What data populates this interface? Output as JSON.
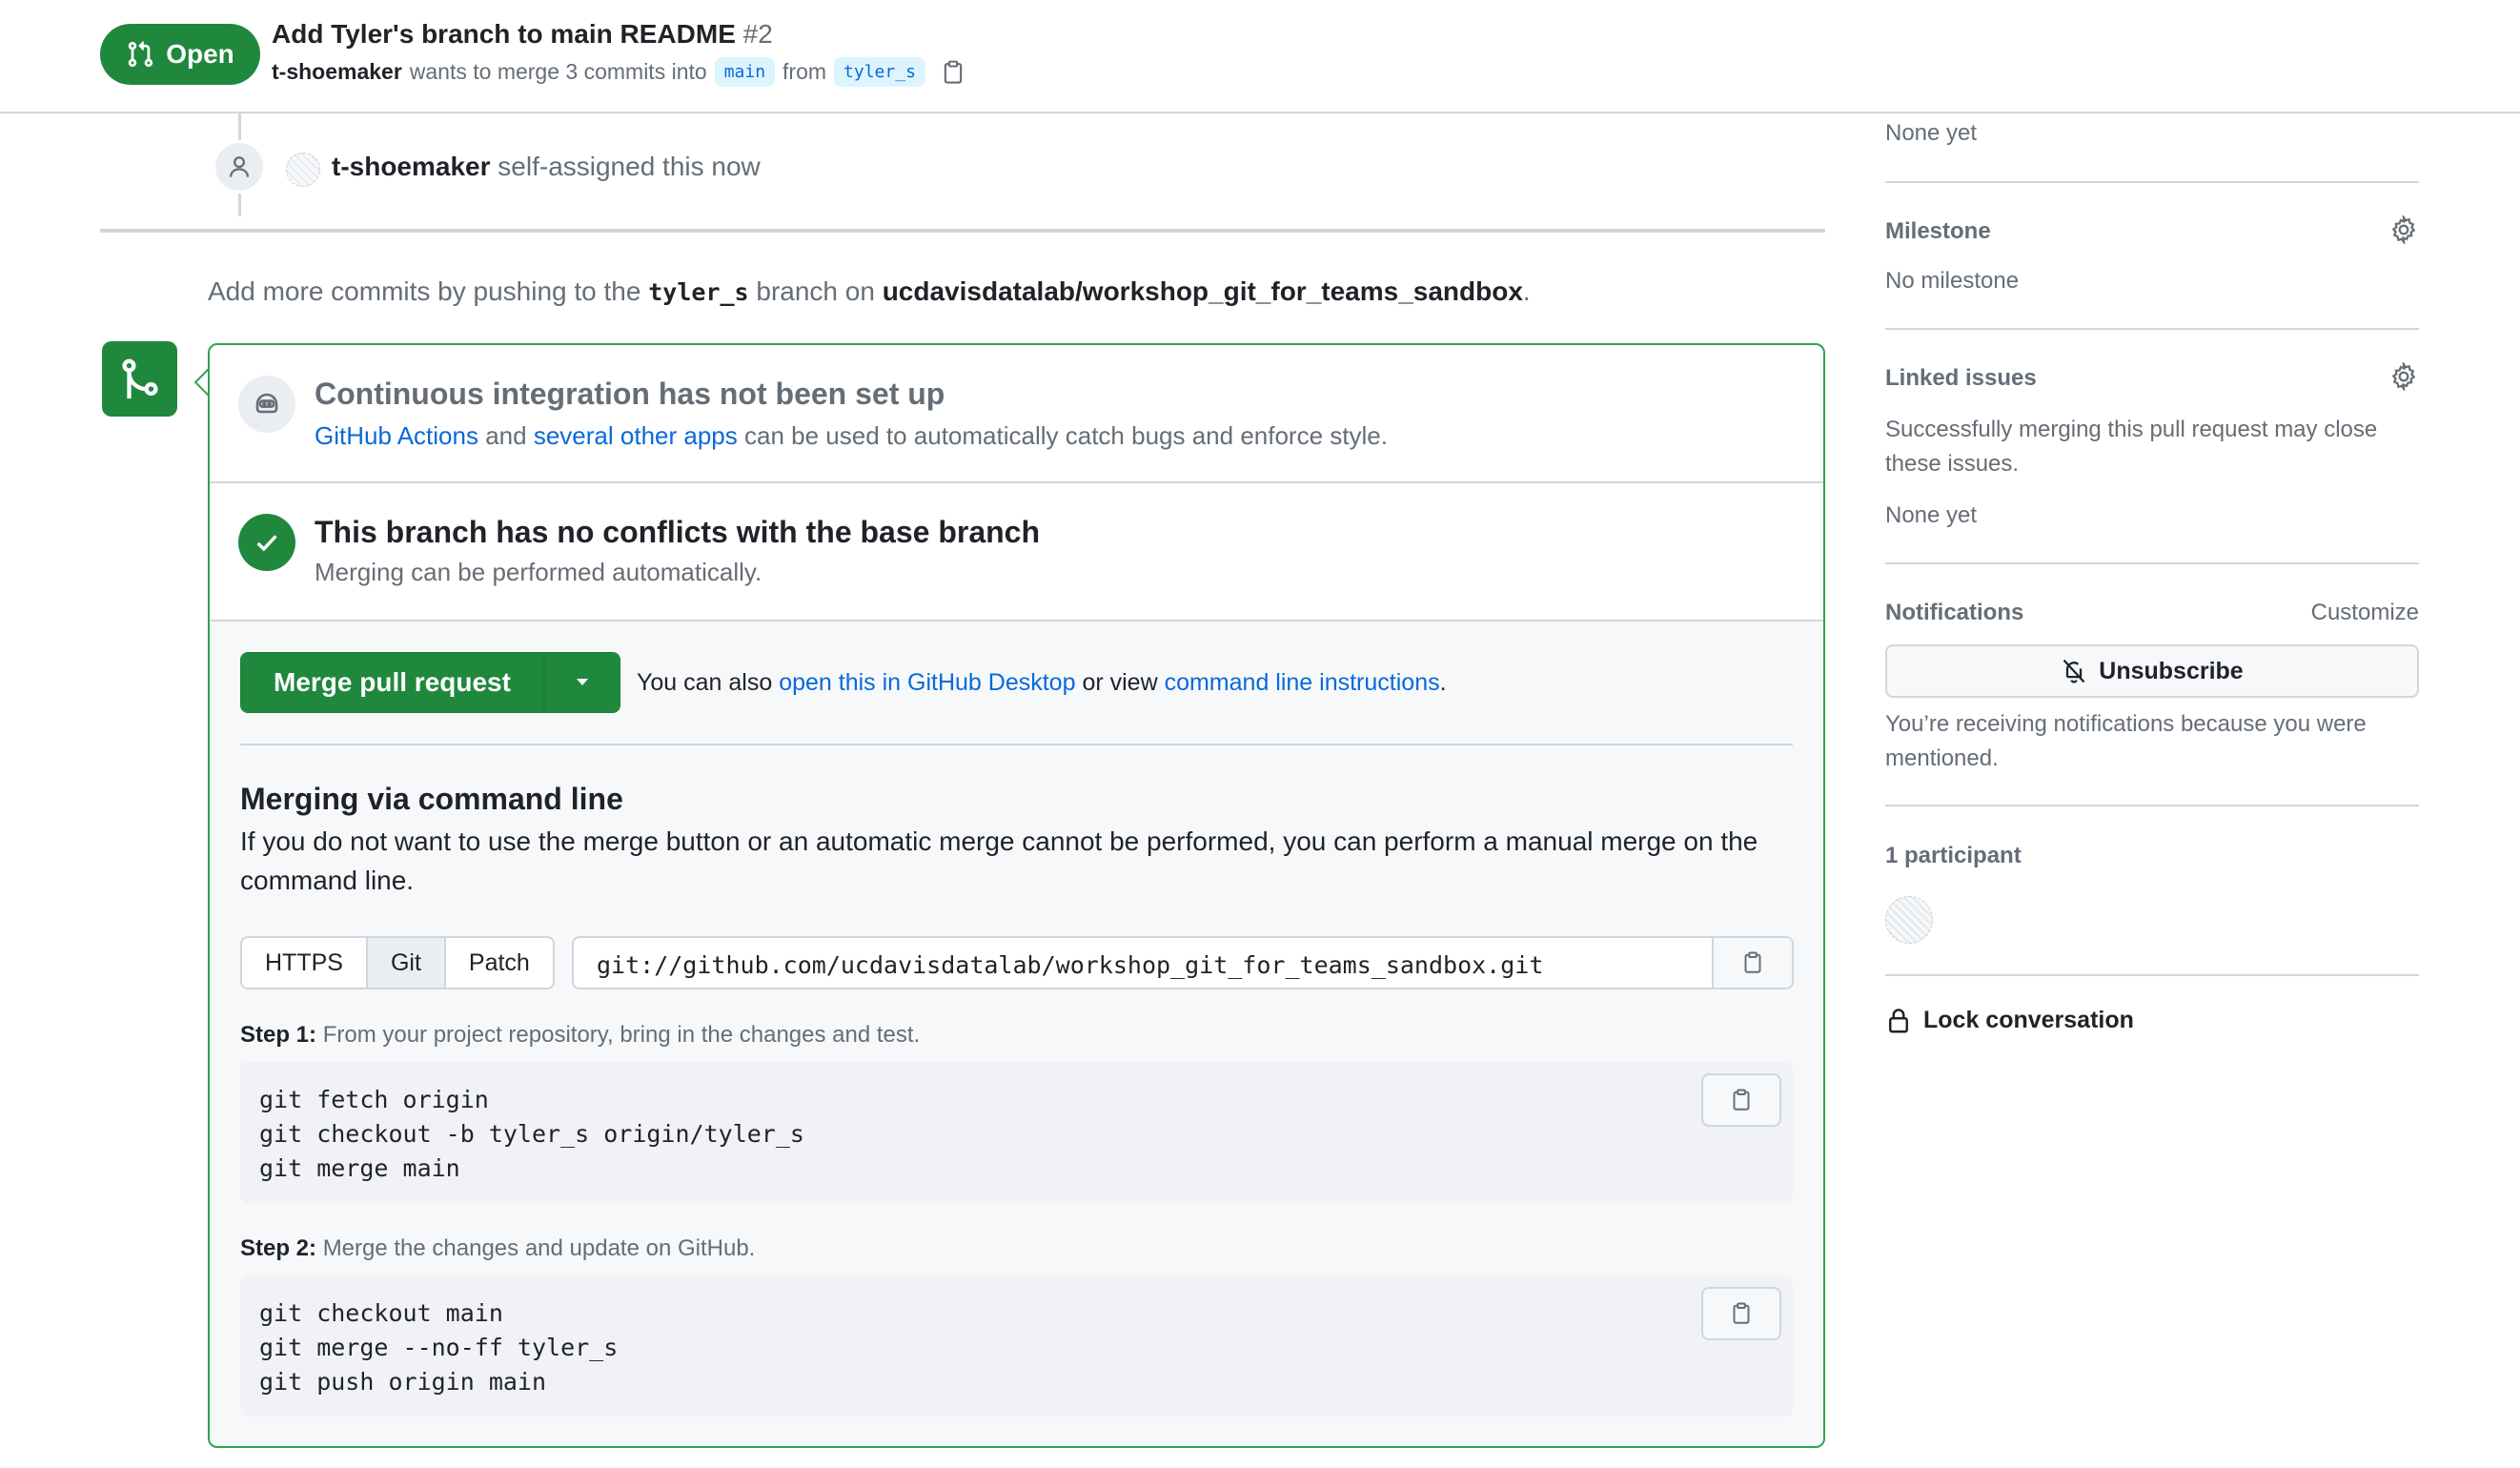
{
  "header": {
    "state": "Open",
    "title": "Add Tyler's branch to main README",
    "number": "#2",
    "author": "t-shoemaker",
    "merge_text": "wants to merge 3 commits into",
    "base_branch": "main",
    "from_text": "from",
    "head_branch": "tyler_s"
  },
  "timeline": {
    "event_actor": "t-shoemaker",
    "event_text": "self-assigned this now"
  },
  "hint": {
    "prefix": "Add more commits by pushing to the",
    "branch": "tyler_s",
    "middle": "branch on",
    "repo": "ucdavisdatalab/workshop_git_for_teams_sandbox",
    "suffix": "."
  },
  "merge_box": {
    "ci": {
      "heading": "Continuous integration has not been set up",
      "link1": "GitHub Actions",
      "and": "and",
      "link2": "several other apps",
      "rest": "can be used to automatically catch bugs and enforce style."
    },
    "conflicts": {
      "heading": "This branch has no conflicts with the base branch",
      "sub": "Merging can be performed automatically."
    },
    "merge": {
      "button": "Merge pull request",
      "alt_prefix": "You can also",
      "alt_link1": "open this in GitHub Desktop",
      "alt_middle": "or view",
      "alt_link2": "command line instructions",
      "alt_suffix": "."
    },
    "cli": {
      "heading": "Merging via command line",
      "description": "If you do not want to use the merge button or an automatic merge cannot be performed, you can perform a manual merge on the command line.",
      "tabs": [
        "HTTPS",
        "Git",
        "Patch"
      ],
      "selected_tab": "Git",
      "clone_url": "git://github.com/ucdavisdatalab/workshop_git_for_teams_sandbox.git",
      "step1_label": "Step 1:",
      "step1_text": "From your project repository, bring in the changes and test.",
      "step1_code": "git fetch origin\ngit checkout -b tyler_s origin/tyler_s\ngit merge main",
      "step2_label": "Step 2:",
      "step2_text": "Merge the changes and update on GitHub.",
      "step2_code": "git checkout main\ngit merge --no-ff tyler_s\ngit push origin main"
    }
  },
  "sidebar": {
    "projects_value": "None yet",
    "milestone_heading": "Milestone",
    "milestone_value": "No milestone",
    "linked_heading": "Linked issues",
    "linked_desc": "Successfully merging this pull request may close these issues.",
    "linked_value": "None yet",
    "notifications_heading": "Notifications",
    "customize": "Customize",
    "unsubscribe": "Unsubscribe",
    "notifications_reason": "You’re receiving notifications because you were mentioned.",
    "participants_heading": "1 participant",
    "lock": "Lock conversation"
  },
  "colors": {
    "accent_green": "#1f883d",
    "link_blue": "#0969da",
    "muted": "#656d76",
    "border": "#d0d7de"
  }
}
